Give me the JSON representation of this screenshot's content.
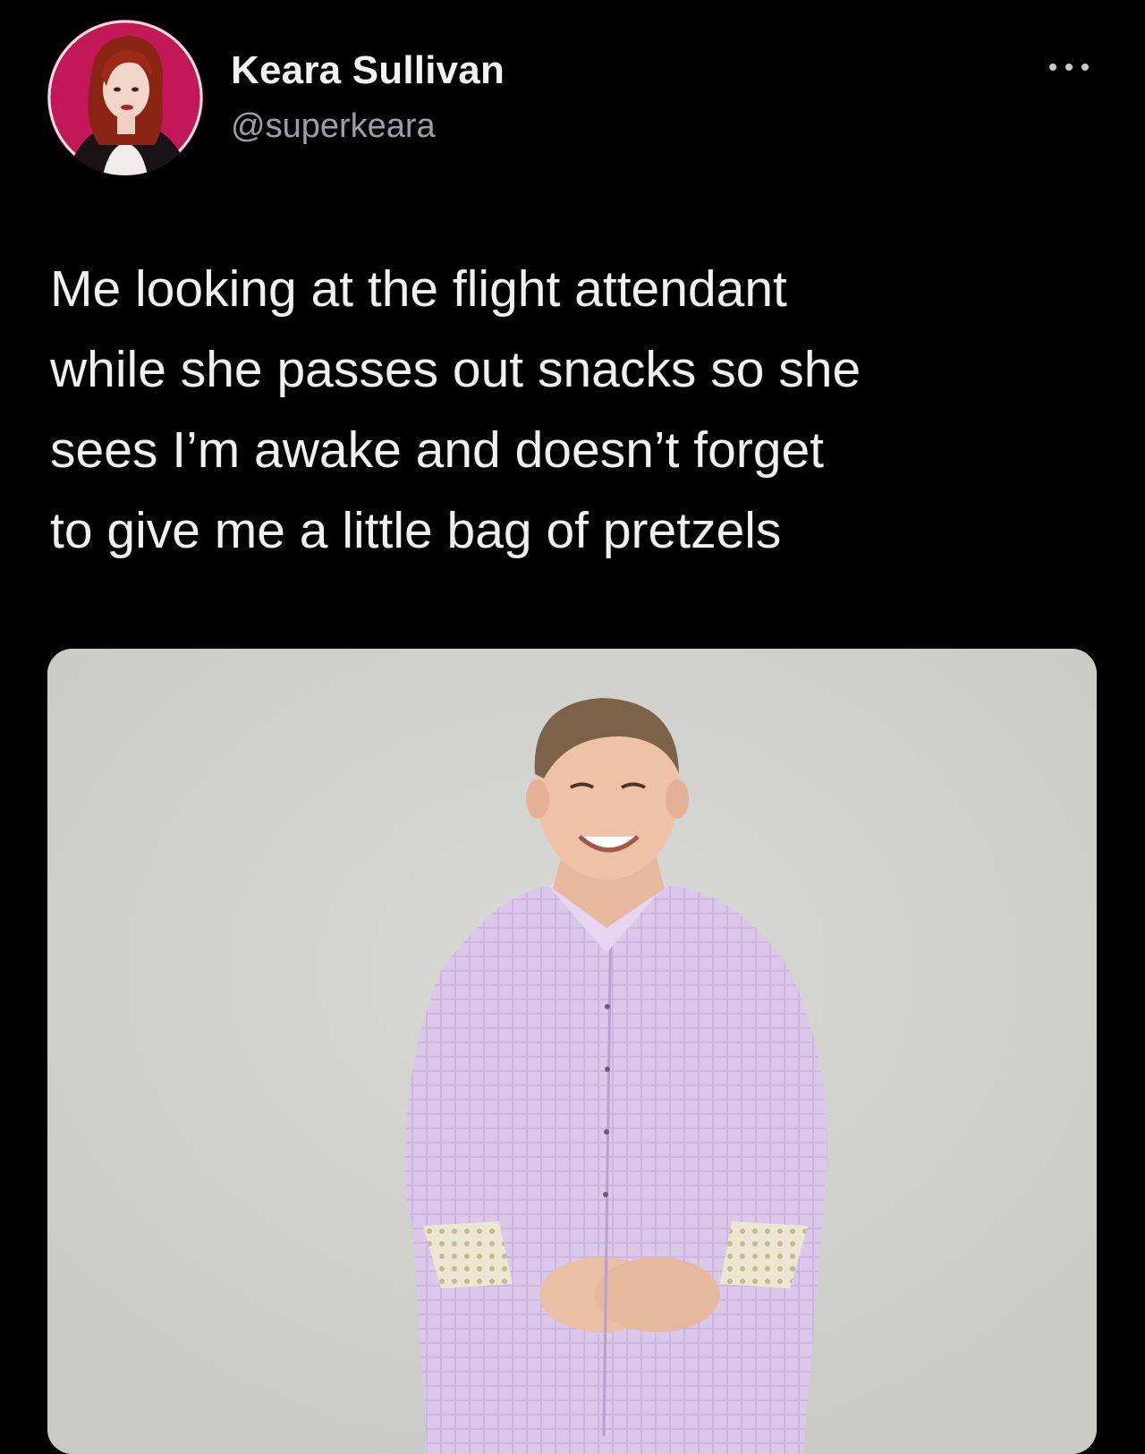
{
  "tweet": {
    "display_name": "Keara Sullivan",
    "handle": "@superkeara",
    "more_icon": "more-horizontal-icon",
    "text": "Me looking at the flight attendant\nwhile she passes out snacks so she\nsees I’m awake and doesn’t forget\nto give me a little bag of pretzels"
  },
  "colors": {
    "background": "#000000",
    "avatar_bg": "#c21856",
    "media_bg": "#d3d3d0",
    "shirt": "#dcc8ea"
  }
}
